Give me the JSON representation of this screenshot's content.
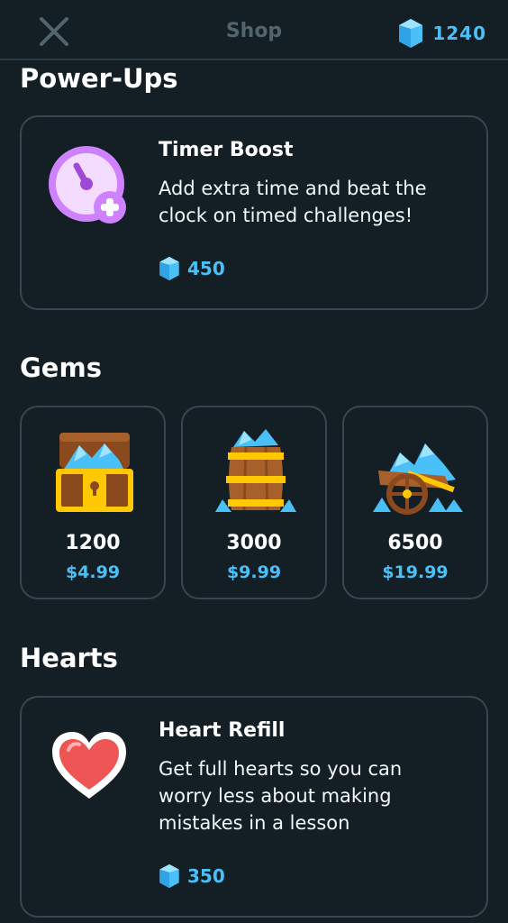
{
  "header": {
    "title": "Shop",
    "gem_balance": "1240",
    "close_icon": "close-icon",
    "gem_icon": "gem-icon"
  },
  "powerups": {
    "section_title": "Power-Ups",
    "item": {
      "name": "Timer Boost",
      "description": "Add extra time and beat the clock on timed challenges!",
      "price": "450",
      "icon": "timer-boost-icon"
    }
  },
  "gems": {
    "section_title": "Gems",
    "packs": [
      {
        "amount": "1200",
        "price": "$4.99",
        "icon": "treasure-chest-icon"
      },
      {
        "amount": "3000",
        "price": "$9.99",
        "icon": "barrel-icon"
      },
      {
        "amount": "6500",
        "price": "$19.99",
        "icon": "wagon-icon"
      }
    ]
  },
  "hearts": {
    "section_title": "Hearts",
    "item": {
      "name": "Heart Refill",
      "description": "Get full hearts so you can worry less about making mistakes in a lesson",
      "price": "350",
      "icon": "heart-icon"
    }
  },
  "colors": {
    "background": "#131f24",
    "card_border": "#37464f",
    "accent_blue": "#49c0f8",
    "muted_title": "#52656d",
    "timer_purple": "#ce82ff",
    "heart_red": "#ee5555"
  }
}
